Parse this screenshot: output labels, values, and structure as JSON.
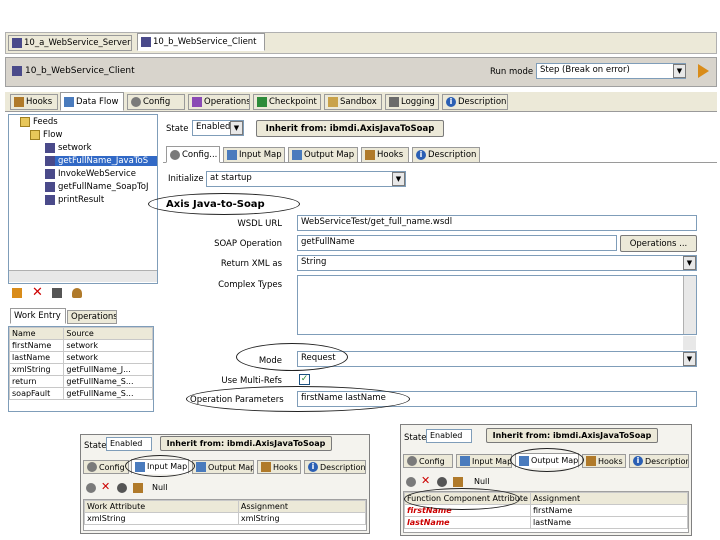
{
  "doc_tabs": [
    "10_a_WebService_Server",
    "10_b_WebService_Client"
  ],
  "header": {
    "title": "10_b_WebService_Client",
    "run_mode_label": "Run mode",
    "run_mode_value": "Step (Break on error)"
  },
  "main_tabs": [
    "Hooks",
    "Data Flow",
    "Config",
    "Operations",
    "Checkpoint",
    "Sandbox",
    "Logging",
    "Description"
  ],
  "tree": {
    "items": [
      "Feeds",
      "Flow",
      "setwork",
      "getFullName_JavaToS",
      "InvokeWebService",
      "getFullName_SoapToJ",
      "printResult"
    ]
  },
  "work_tabs": [
    "Work Entry",
    "Operations"
  ],
  "work_table": {
    "headers": [
      "Name",
      "Source"
    ],
    "rows": [
      [
        "firstName",
        "setwork"
      ],
      [
        "lastName",
        "setwork"
      ],
      [
        "xmlString",
        "getFullName_J..."
      ],
      [
        "return",
        "getFullName_S..."
      ],
      [
        "soapFault",
        "getFullName_S..."
      ]
    ]
  },
  "state": {
    "label": "State",
    "value": "Enabled",
    "inherit_button": "Inherit from: ibmdi.AxisJavaToSoap"
  },
  "sub_tabs": [
    "Config...",
    "Input Map",
    "Output Map",
    "Hooks",
    "Description"
  ],
  "initialize": {
    "label": "Initialize",
    "value": "at startup"
  },
  "section_title": "Axis Java-to-Soap",
  "form": {
    "wsdl_label": "WSDL URL",
    "wsdl_value": "WebServiceTest/get_full_name.wsdl",
    "soapop_label": "SOAP Operation",
    "soapop_value": "getFullName",
    "operations_button": "Operations ...",
    "returnxml_label": "Return XML as",
    "returnxml_value": "String",
    "complex_label": "Complex Types",
    "mode_label": "Mode",
    "mode_value": "Request",
    "multiref_label": "Use Multi-Refs",
    "opparams_label": "Operation Parameters",
    "opparams_value": "firstName lastName"
  },
  "inset_left": {
    "state_label": "State",
    "state_value": "Enabled",
    "inherit_button": "Inherit from: ibmdi.AxisJavaToSoap",
    "tabs": [
      "Config",
      "Input Map",
      "Output Map",
      "Hooks",
      "Description"
    ],
    "null_label": "Null",
    "headers": [
      "Work Attribute",
      "Assignment"
    ],
    "rows": [
      [
        "xmlString",
        "xmlString"
      ]
    ]
  },
  "inset_right": {
    "state_label": "State",
    "state_value": "Enabled",
    "inherit_button": "Inherit from: ibmdi.AxisJavaToSoap",
    "tabs": [
      "Config",
      "Input Map",
      "Output Map",
      "Hooks",
      "Description"
    ],
    "null_label": "Null",
    "headers": [
      "Function Component Attribute",
      "Assignment"
    ],
    "rows": [
      [
        "firstName",
        "firstName"
      ],
      [
        "lastName",
        "lastName"
      ]
    ]
  },
  "colors": {
    "panel": "#d4d0c8",
    "tab_active": "#ffffff",
    "highlight_red": "#cc0000"
  }
}
